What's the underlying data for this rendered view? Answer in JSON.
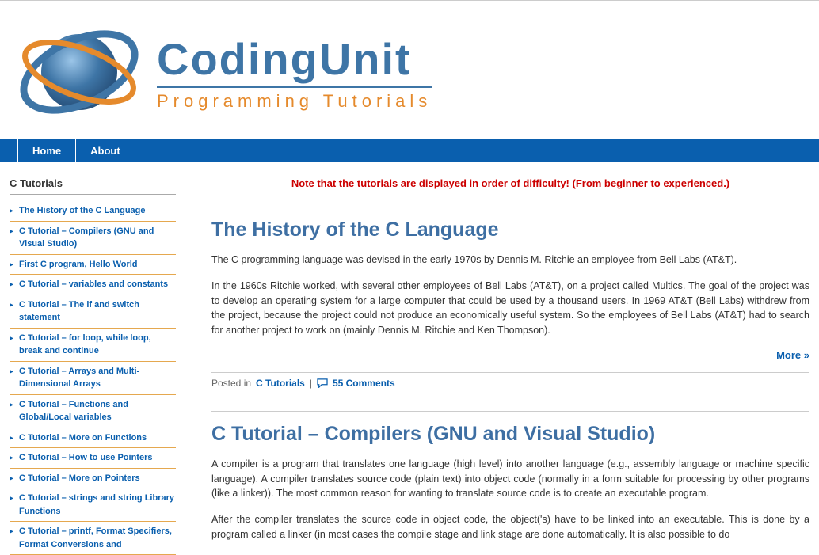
{
  "site": {
    "title": "CodingUnit",
    "subtitle": "Programming Tutorials"
  },
  "nav": [
    {
      "label": "Home"
    },
    {
      "label": "About"
    }
  ],
  "sidebar": {
    "title": "C Tutorials",
    "items": [
      "The History of the C Language",
      "C Tutorial – Compilers (GNU and Visual Studio)",
      "First C program, Hello World",
      "C Tutorial – variables and constants",
      "C Tutorial – The if and switch statement",
      "C Tutorial – for loop, while loop, break and continue",
      "C Tutorial – Arrays and Multi-Dimensional Arrays",
      "C Tutorial – Functions and Global/Local variables",
      "C Tutorial – More on Functions",
      "C Tutorial – How to use Pointers",
      "C Tutorial – More on Pointers",
      "C Tutorial – strings and string Library Functions",
      "C Tutorial – printf, Format Specifiers, Format Conversions and"
    ]
  },
  "notice": "Note that the tutorials are displayed in order of difficulty! (From beginner to experienced.)",
  "articles": [
    {
      "title": "The History of the C Language",
      "paragraphs": [
        "The C programming language was devised in the early 1970s by Dennis M. Ritchie an employee from Bell Labs (AT&T).",
        "In the 1960s Ritchie worked, with several other employees of Bell Labs (AT&T), on a project called Multics. The goal of the project was to develop an operating system for a large computer that could be used by a thousand users. In 1969 AT&T (Bell Labs) withdrew from the project, because the project could not produce an economically useful system. So the employees of Bell Labs (AT&T) had to search for another project to work on (mainly Dennis M. Ritchie and Ken Thompson)."
      ],
      "more": "More »",
      "meta": {
        "prefix": "Posted in ",
        "category": "C Tutorials",
        "comments": "55 Comments"
      }
    },
    {
      "title": "C Tutorial – Compilers (GNU and Visual Studio)",
      "paragraphs": [
        "A compiler is a program that translates one language (high level) into another language (e.g., assembly language or machine specific language). A compiler translates source code (plain text) into object code (normally in a form suitable for processing by other programs (like a linker)). The most common reason for wanting to translate source code is to create an executable program.",
        "After the compiler translates the source code in object code, the object('s) have to be linked into an executable. This is done by a program called a linker (in most cases the compile stage and link stage are done automatically. It is also possible to do"
      ]
    }
  ]
}
